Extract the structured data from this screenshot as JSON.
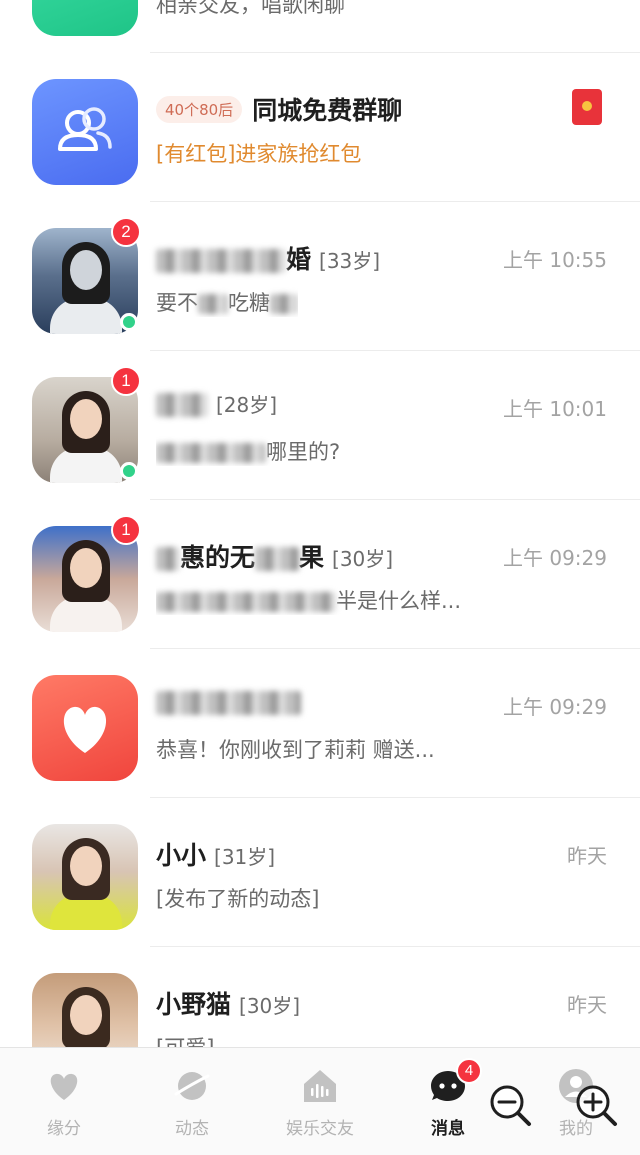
{
  "messages": [
    {
      "name": "",
      "age": "",
      "time": "",
      "preview": "相亲交友，唱歌闲聊",
      "badge": "",
      "online": false
    },
    {
      "tag": "40个80后",
      "name": "同城免费群聊",
      "preview": "[有红包]进家族抢红包",
      "has_red_packet": true
    },
    {
      "name": "婚",
      "age": "[33岁]",
      "time": "上午 10:55",
      "preview": "要不",
      "preview2": "吃糖",
      "badge": "2",
      "online": true
    },
    {
      "name": "",
      "age": "[28岁]",
      "time": "上午 10:01",
      "preview": "哪里的?",
      "badge": "1",
      "online": true
    },
    {
      "name": "惠的无",
      "name2": "果",
      "age": "[30岁]",
      "time": "上午 09:29",
      "preview": "半是什么样...",
      "badge": "1",
      "online": false
    },
    {
      "name": "",
      "age": "",
      "time": "上午 09:29",
      "preview": "恭喜！你刚收到了莉莉 赠送...",
      "badge": "",
      "online": false
    },
    {
      "name": "小小",
      "age": "[31岁]",
      "time": "昨天",
      "preview": "[发布了新的动态]",
      "badge": "",
      "online": false
    },
    {
      "name": "小野猫",
      "age": "[30岁]",
      "time": "昨天",
      "preview": "[可爱]",
      "badge": "",
      "online": false
    }
  ],
  "tabbar": {
    "tabs": [
      {
        "label": "缘分",
        "icon": "heart-icon"
      },
      {
        "label": "动态",
        "icon": "planet-icon"
      },
      {
        "label": "娱乐交友",
        "icon": "voice-room-icon"
      },
      {
        "label": "消息",
        "icon": "chat-icon",
        "badge": "4",
        "active": true
      },
      {
        "label": "我的",
        "icon": "profile-icon"
      }
    ]
  },
  "colors": {
    "badge": "#f5333f",
    "online": "#31d28a",
    "promo_text": "#e08a2f",
    "tag_text": "#cf6c55"
  }
}
